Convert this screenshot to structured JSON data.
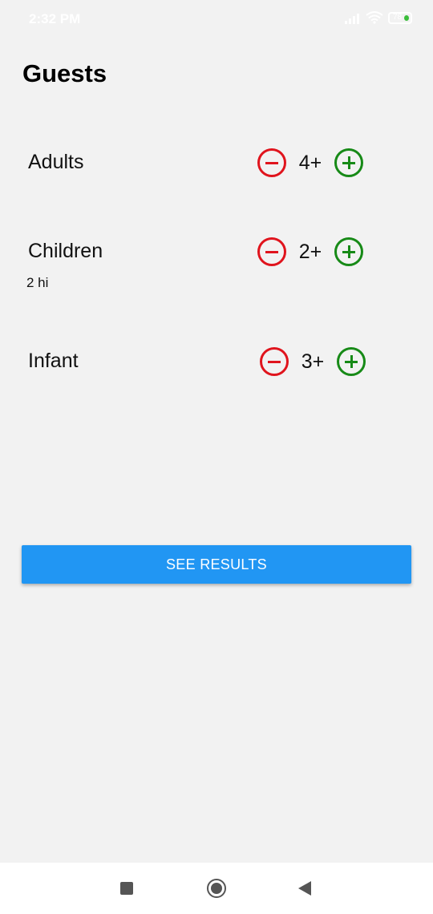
{
  "status_bar": {
    "time": "2:32 PM",
    "battery": "78",
    "icons": [
      "signal-icon",
      "wifi-icon",
      "battery-icon"
    ]
  },
  "page": {
    "title": "Guests"
  },
  "guests": [
    {
      "label": "Adults",
      "value": "4+",
      "sub": ""
    },
    {
      "label": "Children",
      "value": "2+",
      "sub": "2 hi"
    },
    {
      "label": "Infant",
      "value": "3+",
      "sub": ""
    }
  ],
  "actions": {
    "see_results": "SEE RESULTS"
  },
  "colors": {
    "minus": "#e0141d",
    "plus": "#178a17",
    "button": "#2196f3",
    "background": "#f2f2f2"
  },
  "nav_bar": {
    "icons": [
      "recent-apps-icon",
      "home-icon",
      "back-icon"
    ]
  }
}
